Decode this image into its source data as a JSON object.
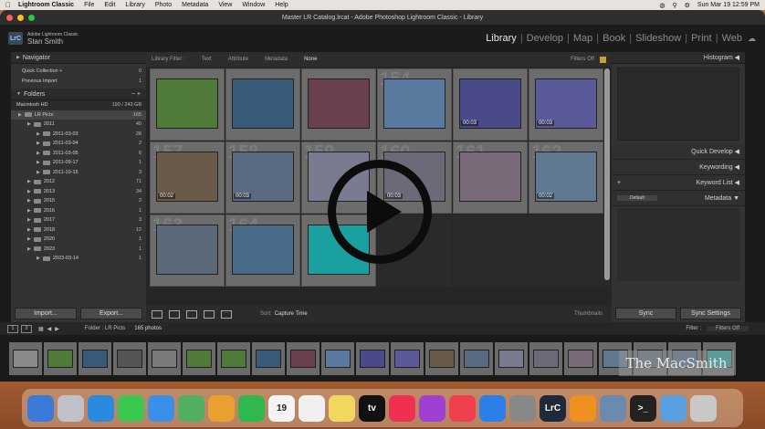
{
  "menubar": {
    "app": "Lightroom Classic",
    "items": [
      "File",
      "Edit",
      "Library",
      "Photo",
      "Metadata",
      "View",
      "Window",
      "Help"
    ],
    "clock": "Sun Mar 19  12:59 PM"
  },
  "window": {
    "title": "Master LR Catalog.lrcat - Adobe Photoshop Lightroom Classic - Library"
  },
  "identity": {
    "badge": "LrC",
    "app_name": "Adobe Lightroom Classic",
    "user": "Stan Smith"
  },
  "modules": [
    "Library",
    "Develop",
    "Map",
    "Book",
    "Slideshow",
    "Print",
    "Web"
  ],
  "left_panel": {
    "navigator": "Navigator",
    "catalog_items": [
      {
        "label": "Quick Collection +",
        "count": "0"
      },
      {
        "label": "Previous Import",
        "count": "1"
      }
    ],
    "folders_label": "Folders",
    "volume": {
      "label": "Macintosh HD",
      "size": "190 / 243 GB"
    },
    "folders": [
      {
        "label": "LR Picts",
        "count": "165",
        "level": 0
      },
      {
        "label": "2011",
        "count": "40",
        "level": 1
      },
      {
        "label": "2011-03-03",
        "count": "28",
        "level": 2
      },
      {
        "label": "2011-03-04",
        "count": "2",
        "level": 2
      },
      {
        "label": "2011-03-05",
        "count": "6",
        "level": 2
      },
      {
        "label": "2011-09-17",
        "count": "1",
        "level": 2
      },
      {
        "label": "2011-10-15",
        "count": "3",
        "level": 2
      },
      {
        "label": "2012",
        "count": "71",
        "level": 1
      },
      {
        "label": "2013",
        "count": "34",
        "level": 1
      },
      {
        "label": "2015",
        "count": "2",
        "level": 1
      },
      {
        "label": "2016",
        "count": "1",
        "level": 1
      },
      {
        "label": "2017",
        "count": "3",
        "level": 1
      },
      {
        "label": "2018",
        "count": "12",
        "level": 1
      },
      {
        "label": "2020",
        "count": "1",
        "level": 1
      },
      {
        "label": "2023",
        "count": "1",
        "level": 1
      },
      {
        "label": "2023-03-14",
        "count": "1",
        "level": 2
      }
    ],
    "import_label": "Import...",
    "export_label": "Export..."
  },
  "filter_bar": {
    "label": "Library Filter :",
    "options": [
      "Text",
      "Attribute",
      "Metadata",
      "None"
    ],
    "active": "None",
    "status": "Filters Off"
  },
  "grid": [
    {
      "num": "",
      "color": "#4f7a3a",
      "duration": ""
    },
    {
      "num": "",
      "color": "#3a5a7a",
      "duration": ""
    },
    {
      "num": "",
      "color": "#6a4050",
      "duration": ""
    },
    {
      "num": "154",
      "color": "#5a7aa0",
      "duration": ""
    },
    {
      "num": "",
      "color": "#4a4a8a",
      "duration": "00:03"
    },
    {
      "num": "",
      "color": "#5a5a9a",
      "duration": "00:03"
    },
    {
      "num": "157",
      "color": "#6a5a4a",
      "duration": "00:02"
    },
    {
      "num": "158",
      "color": "#5a6a80",
      "duration": "00:03"
    },
    {
      "num": "159",
      "color": "#7a7a90",
      "duration": ""
    },
    {
      "num": "160",
      "color": "#6a6a78",
      "duration": "00:03"
    },
    {
      "num": "161",
      "color": "#7a6a7a",
      "duration": ""
    },
    {
      "num": "162",
      "color": "#607890",
      "duration": "00:02"
    },
    {
      "num": "163",
      "color": "#5a6878",
      "duration": ""
    },
    {
      "num": "164",
      "color": "#4a6a8a",
      "duration": ""
    },
    {
      "num": "",
      "color": "#1aa0a0",
      "duration": ""
    },
    {
      "num": "",
      "color": "",
      "duration": ""
    },
    {
      "num": "",
      "color": "",
      "duration": ""
    },
    {
      "num": "",
      "color": "",
      "duration": ""
    }
  ],
  "toolbar": {
    "sort_label": "Sort:",
    "sort_value": "Capture Time",
    "thumbnails_label": "Thumbnails"
  },
  "right_panel": {
    "histogram": "Histogram",
    "quick_develop": "Quick Develop",
    "keywording": "Keywording",
    "keyword_list": "Keyword List",
    "metadata": "Metadata",
    "metadata_preset": "Default",
    "sync_label": "Sync",
    "sync_settings_label": "Sync Settings"
  },
  "filmstrip_bar": {
    "pages": [
      "1",
      "2"
    ],
    "crumb": "Folder : LR Picts",
    "photo_count": "165 photos",
    "filter_label": "Filter :",
    "filter_value": "Filters Off"
  },
  "filmstrip_colors": [
    "#8a8a8a",
    "#4f7a3a",
    "#3a5a7a",
    "#555",
    "#7a7a7a",
    "#4f7a3a",
    "#4f7a3a",
    "#3a5a7a",
    "#6a4050",
    "#5a7aa0",
    "#4a4a8a",
    "#5a5a9a",
    "#6a5a4a",
    "#5a6a80",
    "#7a7a90",
    "#6a6a78",
    "#7a6a7a",
    "#607890",
    "#5a6878",
    "#4a6a8a",
    "#1aa0a0"
  ],
  "watermark": "The MacSmith",
  "dock": [
    {
      "name": "finder",
      "color": "#3a7ad8",
      "label": ""
    },
    {
      "name": "launchpad",
      "color": "#c0c0c8",
      "label": ""
    },
    {
      "name": "safari",
      "color": "#2a8ae0",
      "label": ""
    },
    {
      "name": "messages",
      "color": "#3ac850",
      "label": ""
    },
    {
      "name": "mail",
      "color": "#3a90e8",
      "label": ""
    },
    {
      "name": "maps",
      "color": "#50b060",
      "label": ""
    },
    {
      "name": "photos",
      "color": "#e8a030",
      "label": ""
    },
    {
      "name": "facetime",
      "color": "#30b850",
      "label": ""
    },
    {
      "name": "calendar",
      "color": "#f4f4f4",
      "label": "19"
    },
    {
      "name": "reminders",
      "color": "#f0f0f0",
      "label": ""
    },
    {
      "name": "notes",
      "color": "#f0d860",
      "label": ""
    },
    {
      "name": "appletv",
      "color": "#111",
      "label": "tv"
    },
    {
      "name": "music",
      "color": "#f03050",
      "label": ""
    },
    {
      "name": "podcasts",
      "color": "#a040d0",
      "label": ""
    },
    {
      "name": "news",
      "color": "#f04050",
      "label": ""
    },
    {
      "name": "appstore",
      "color": "#2a80e8",
      "label": ""
    },
    {
      "name": "settings",
      "color": "#888",
      "label": ""
    },
    {
      "name": "lightroom",
      "color": "#1e2a3a",
      "label": "LrC"
    },
    {
      "name": "pages",
      "color": "#f09020",
      "label": ""
    },
    {
      "name": "preview",
      "color": "#6a8ab0",
      "label": ""
    },
    {
      "name": "terminal",
      "color": "#222",
      "label": ">_"
    },
    {
      "name": "downloads",
      "color": "#5aa0e0",
      "label": ""
    },
    {
      "name": "trash",
      "color": "#c8c8c8",
      "label": ""
    }
  ]
}
